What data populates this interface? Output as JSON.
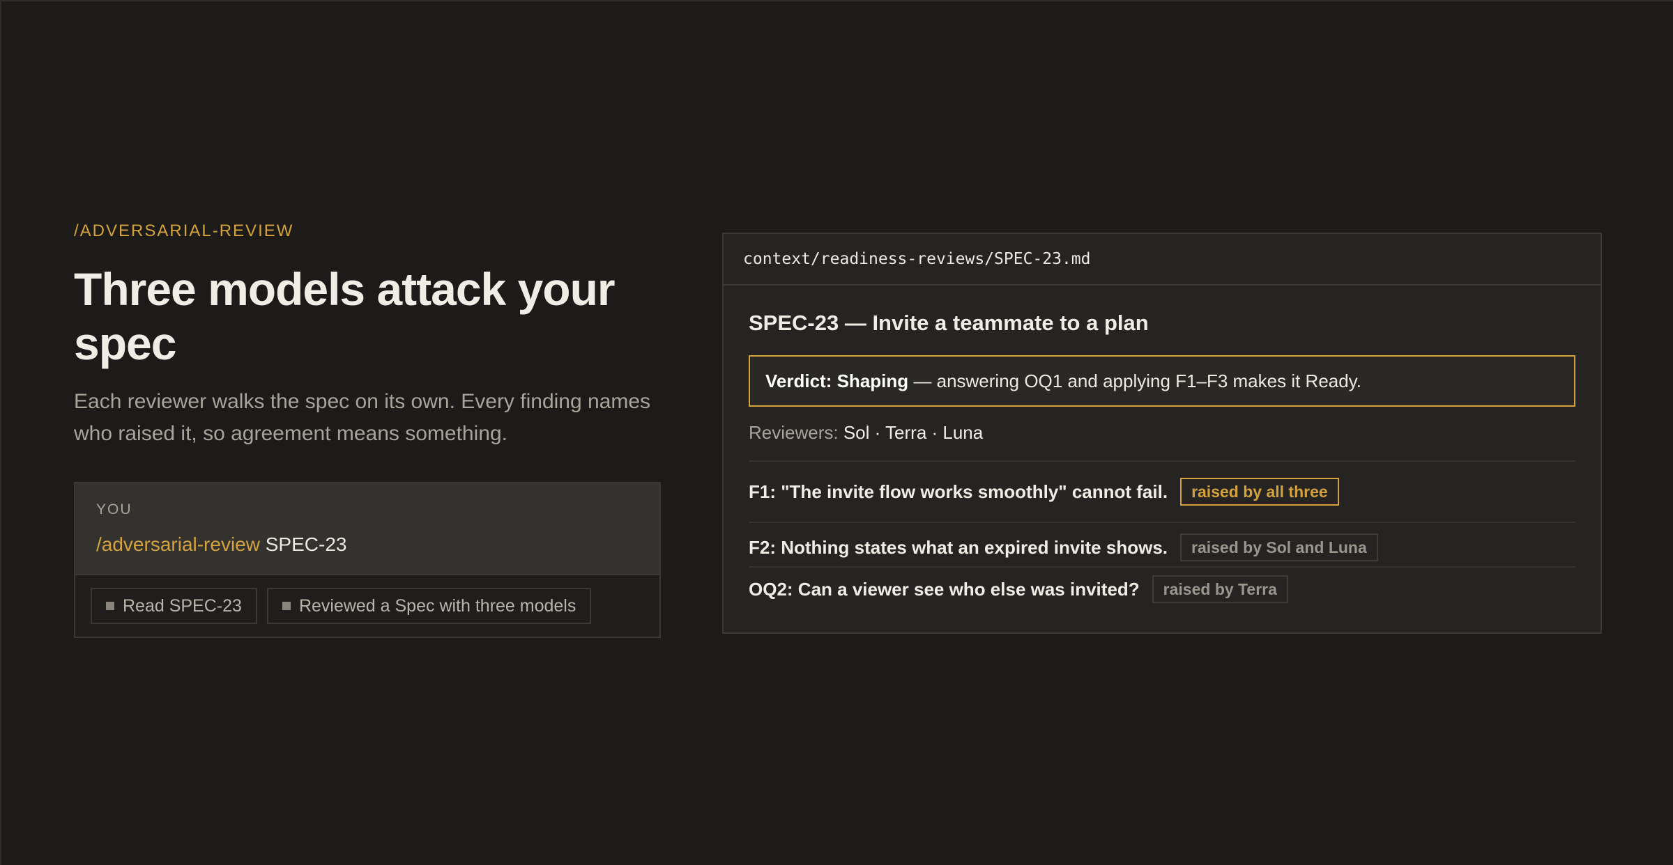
{
  "left": {
    "eyebrow": "/ADVERSARIAL-REVIEW",
    "headline": "Three models attack your spec",
    "subhead": "Each reviewer walks the spec on its own. Every finding names who raised it, so agreement means something.",
    "chat": {
      "role_label": "YOU",
      "command_name": "/adversarial-review",
      "command_arg": "SPEC-23",
      "steps": [
        {
          "label": "Read SPEC-23"
        },
        {
          "label": "Reviewed a Spec with three models"
        }
      ]
    }
  },
  "panel": {
    "file_path": "context/readiness-reviews/SPEC-23.md",
    "title": "SPEC-23 — Invite a teammate to a plan",
    "verdict_label": "Verdict: Shaping",
    "verdict_text": " — answering OQ1 and applying F1–F3 makes it Ready.",
    "reviewers_label": "Reviewers: ",
    "reviewers_names": "Sol · Terra · Luna",
    "findings": [
      {
        "text": "F1: \"The invite flow works smoothly\" cannot fail.",
        "tag": "raised by all three",
        "tag_color": "#d4a23c"
      },
      {
        "text": "F2: Nothing states what an expired invite shows.",
        "tag": "raised by Sol and Luna",
        "tag_color": "#9a968e"
      },
      {
        "text": "OQ2: Can a viewer see who else was invited?",
        "tag": "raised by Terra",
        "tag_color": "#9a968e"
      }
    ]
  },
  "colors": {
    "background": "#1c1b19",
    "accent": "#d4a23c",
    "panel": "#252422"
  }
}
